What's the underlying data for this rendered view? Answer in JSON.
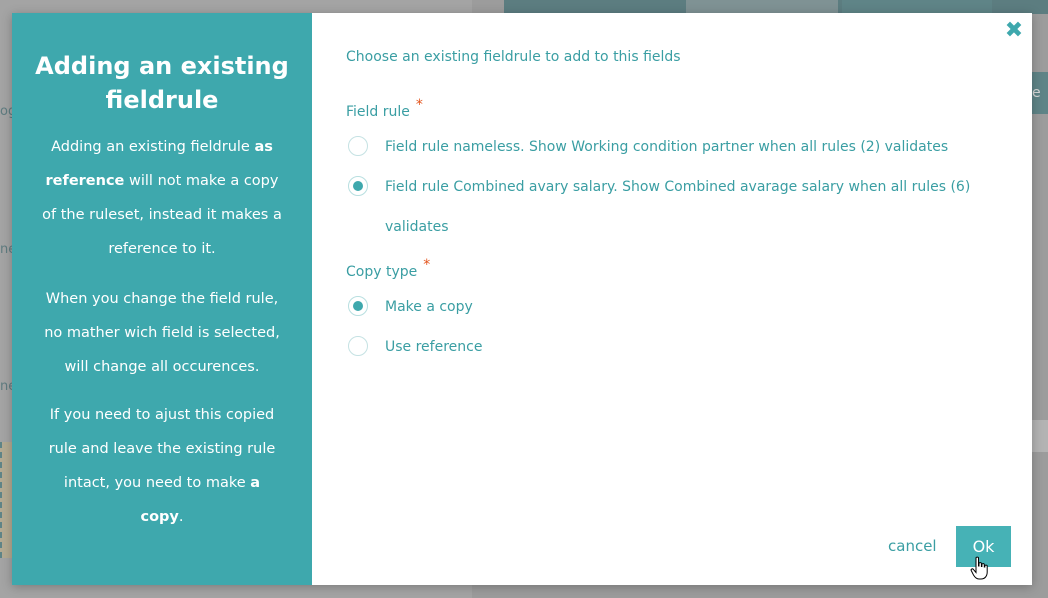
{
  "background": {
    "left_fragments": [
      "og",
      "ne",
      "ne"
    ],
    "right_tab_fragment": "e g"
  },
  "modal": {
    "sidebar": {
      "title": "Adding an existing fieldrule",
      "para1": {
        "a": "Adding an existing fieldrule ",
        "b": "as reference",
        "c": " will not make a copy of the ruleset, instead it makes a reference to it."
      },
      "para2": "When you change the field rule, no mather wich field is selected, will change all occurences.",
      "para3": {
        "a": "If you need to ajust this copied rule and leave the existing rule intact, you need to make ",
        "b": "a copy",
        "c": "."
      }
    },
    "close_glyph": "✖",
    "intro": "Choose an existing fieldrule to add to this fields",
    "field_rule": {
      "label": "Field rule",
      "required_mark": "*",
      "options": [
        {
          "label": "Field rule nameless. Show Working condition partner when all rules (2) validates",
          "checked": false
        },
        {
          "label": "Field rule Combined avary salary. Show Combined avarage salary when all rules (6) validates",
          "checked": true
        }
      ]
    },
    "copy_type": {
      "label": "Copy type",
      "required_mark": "*",
      "options": [
        {
          "label": "Make a copy",
          "checked": true
        },
        {
          "label": "Use reference",
          "checked": false
        }
      ]
    },
    "cancel_label": "cancel",
    "ok_label": "Ok"
  },
  "colors": {
    "accent": "#3ea8ad",
    "required": "#e3531b",
    "text_link": "#3a9ea3"
  }
}
